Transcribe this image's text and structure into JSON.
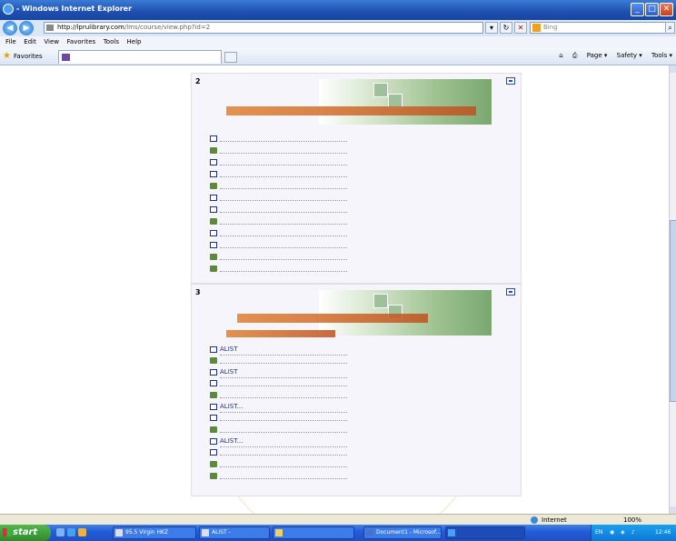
{
  "window": {
    "title": "",
    "title_suffix": "Windows Internet Explorer",
    "controls": {
      "minimize": "_",
      "maximize": "□",
      "close": "✕"
    }
  },
  "address_bar": {
    "url_domain": "http://lprulibrary.com",
    "url_path": "/lms/course/view.php?id=2",
    "search_placeholder": "Bing"
  },
  "menu": [
    "File",
    "Edit",
    "View",
    "Favorites",
    "Tools",
    "Help"
  ],
  "favorites_bar": {
    "favorites_label": "Favorites",
    "tab_title": "",
    "command_items": [
      "Page ▾",
      "Safety ▾",
      "Tools ▾"
    ]
  },
  "sections": [
    {
      "number": "2",
      "banner_title": "",
      "banner_subtitle": "",
      "items": [
        {
          "type": "page",
          "text": ""
        },
        {
          "type": "quiz",
          "text": ""
        },
        {
          "type": "page",
          "text": ""
        },
        {
          "type": "page",
          "text": ""
        },
        {
          "type": "quiz",
          "text": ""
        },
        {
          "type": "page",
          "text": ""
        },
        {
          "type": "page",
          "text": ""
        },
        {
          "type": "quiz",
          "text": ""
        },
        {
          "type": "page",
          "text": ""
        },
        {
          "type": "page",
          "text": ""
        },
        {
          "type": "quiz",
          "text": ""
        },
        {
          "type": "quiz",
          "text": ""
        }
      ]
    },
    {
      "number": "3",
      "banner_title": "",
      "banner_subtitle": "",
      "items": [
        {
          "type": "page",
          "text": "ALIST"
        },
        {
          "type": "quiz",
          "text": ""
        },
        {
          "type": "page",
          "text": "ALIST"
        },
        {
          "type": "page",
          "text": ""
        },
        {
          "type": "quiz",
          "text": ""
        },
        {
          "type": "page",
          "text": "ALIST..."
        },
        {
          "type": "page",
          "text": ""
        },
        {
          "type": "quiz",
          "text": ""
        },
        {
          "type": "page",
          "text": "ALIST..."
        },
        {
          "type": "page",
          "text": ""
        },
        {
          "type": "quiz",
          "text": ""
        },
        {
          "type": "quiz",
          "text": ""
        }
      ]
    }
  ],
  "status_bar": {
    "zone": "Internet",
    "zoom": "100%"
  },
  "taskbar": {
    "start_label": "start",
    "tasks": [
      "95.5 Virgin HKZ",
      "ALIST -",
      "",
      "Document1 - Microsof...",
      ""
    ],
    "tray": {
      "lang": "EN",
      "time": "12:46"
    }
  },
  "colors": {
    "link": "#1a2e9a",
    "banner_title": "#156020",
    "titlebar": "#245edb",
    "taskbar_start": "#3c9a36"
  }
}
